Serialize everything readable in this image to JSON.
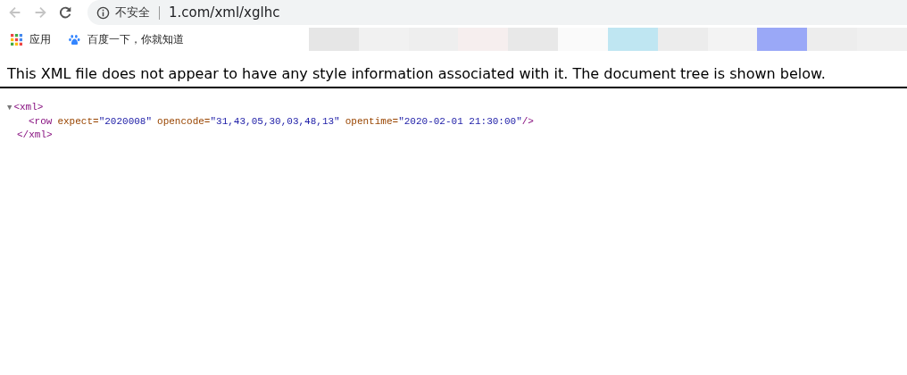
{
  "toolbar": {
    "address": {
      "security_label": "不安全",
      "url": "1.com/xml/xglhc"
    }
  },
  "bookmarks": [
    {
      "label": "应用"
    },
    {
      "label": "百度一下，你就知道"
    }
  ],
  "notice": "This XML file does not appear to have any style information associated with it. The document tree is shown below.",
  "xml_tree": {
    "expanded": true,
    "toggle": "▼",
    "open_tag": "<xml>",
    "close_tag": "</xml>",
    "row": {
      "tag_open": "<row",
      "attributes": [
        {
          "name": "expect=",
          "value": "\"2020008\""
        },
        {
          "name": "opencode=",
          "value": "\"31,43,05,30,03,48,13\""
        },
        {
          "name": "opentime=",
          "value": "\"2020-02-01 21:30:00\""
        }
      ],
      "tag_close": "/>"
    }
  }
}
